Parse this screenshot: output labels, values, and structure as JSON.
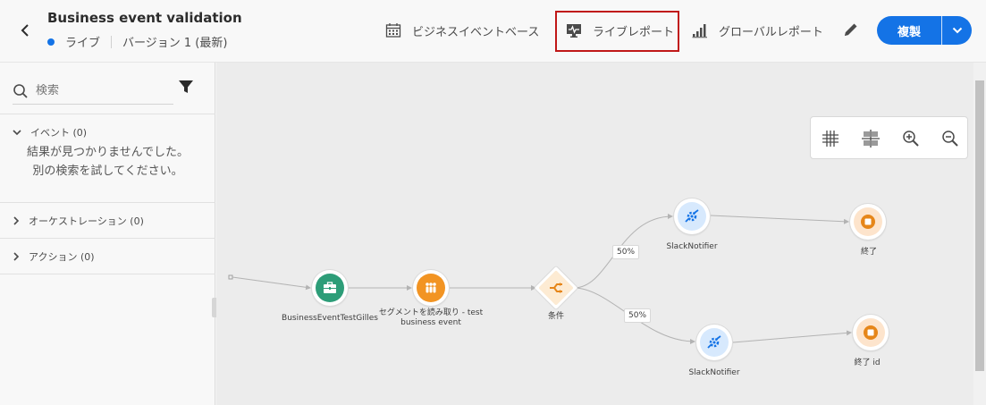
{
  "header": {
    "title": "Business event validation",
    "status": "ライブ",
    "version": "バージョン 1 (最新)",
    "business_event_base": "ビジネスイベントベース",
    "live_report": "ライブレポート",
    "global_report": "グローバルレポート",
    "duplicate": "複製"
  },
  "sidebar": {
    "search_placeholder": "検索",
    "events_label": "イベント (0)",
    "empty_line1": "結果が見つかりませんでした。",
    "empty_line2": "別の検索を試してください。",
    "orchestration_label": "オーケストレーション (0)",
    "actions_label": "アクション (0)"
  },
  "canvas": {
    "nodes": {
      "event": "BusinessEventTestGilles",
      "segment": "セグメントを読み取り - test",
      "segment_line2": "business event",
      "condition": "条件",
      "slack_top": "SlackNotifier",
      "slack_bottom": "SlackNotifier",
      "end_top": "終了",
      "end_bottom": "終了 id"
    },
    "branch_top_pct": "50%",
    "branch_bottom_pct": "50%"
  },
  "colors": {
    "accent": "#1473e6",
    "highlight": "#c01818",
    "event_node": "#2d9d78",
    "segment_node": "#f29423",
    "condition_node": "#e68619",
    "action_node": "#1473e6",
    "end_node": "#e68619"
  },
  "icons": {
    "back": "chevron-left-icon",
    "calendar": "calendar-icon",
    "monitor": "monitor-icon",
    "bars": "bar-chart-icon",
    "pencil": "pencil-icon",
    "search": "search-icon",
    "filter": "filter-icon",
    "grid": "grid-icon",
    "align": "align-icon",
    "zoom_in": "zoom-in-icon",
    "zoom_out": "zoom-out-icon"
  }
}
